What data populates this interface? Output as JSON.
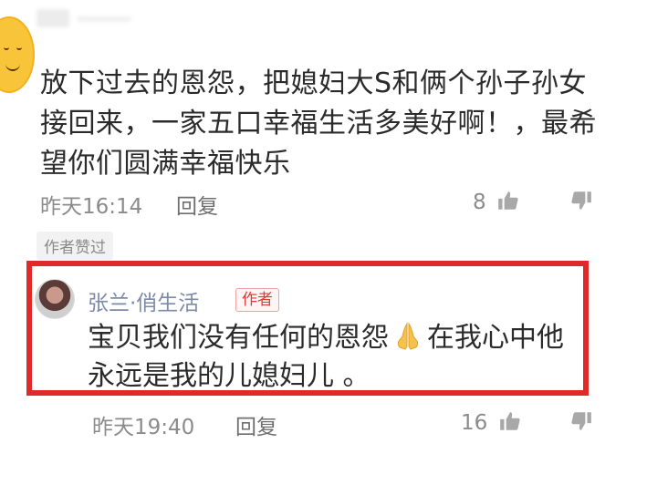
{
  "comment": {
    "text": "放下过去的恩怨，把媳妇大S和俩个孙子孙女接回来，一家五口幸福生活多美好啊！，最希望你们圆满幸福快乐",
    "time": "昨天16:14",
    "reply_label": "回复",
    "like_count": "8",
    "author_liked_label": "作者赞过"
  },
  "reply": {
    "author": "张兰·俏生活",
    "author_tag": "作者",
    "text_before": "宝贝我们没有任何的恩怨",
    "text_after": "在我心中他永远是我的儿媳妇儿 。",
    "time": "昨天19:40",
    "reply_label": "回复",
    "like_count": "16"
  },
  "colors": {
    "highlight": "#e02a2a",
    "author_name": "#7d8aa8",
    "meta": "#8b8b8b"
  },
  "icons": [
    "smiley-avatar-icon",
    "thumbs-up-icon",
    "thumbs-down-icon",
    "praying-hands-emoji"
  ]
}
